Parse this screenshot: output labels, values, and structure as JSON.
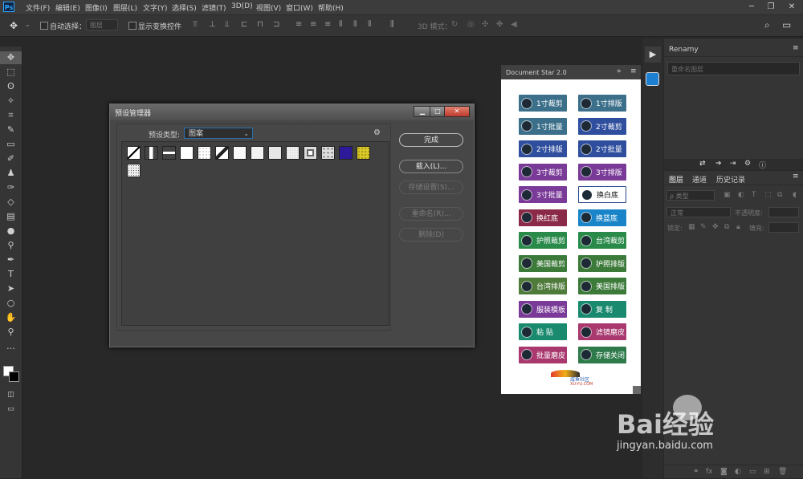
{
  "app": {
    "logo": "Ps"
  },
  "menu": [
    "文件(F)",
    "编辑(E)",
    "图像(I)",
    "图层(L)",
    "文字(Y)",
    "选择(S)",
    "滤镜(T)",
    "3D(D)",
    "视图(V)",
    "窗口(W)",
    "帮助(H)"
  ],
  "window_controls": [
    "─",
    "❐",
    "✕"
  ],
  "options": {
    "auto_select_label": "自动选择：",
    "auto_select_value": "图层",
    "show_transform_label": "显示变换控件",
    "mode_label": "3D 模式："
  },
  "dialog": {
    "title": "预设管理器",
    "preset_type_label": "预设类型:",
    "preset_type_value": "图案",
    "buttons": {
      "done": "完成",
      "load": "载入(L)...",
      "save": "存储设置(S)...",
      "rename": "重命名(R)...",
      "delete": "删除(D)"
    }
  },
  "docstar": {
    "title": "Document Star 2.0",
    "header_controls": "»",
    "buttons": [
      {
        "label": "1寸裁剪",
        "color": "#3b6f8a"
      },
      {
        "label": "1寸排版",
        "color": "#3b6f8a"
      },
      {
        "label": "1寸批量",
        "color": "#3b6f8a"
      },
      {
        "label": "2寸裁剪",
        "color": "#2f4f9e"
      },
      {
        "label": "2寸排版",
        "color": "#2f4f9e"
      },
      {
        "label": "2寸批量",
        "color": "#2f4f9e"
      },
      {
        "label": "3寸裁剪",
        "color": "#7a3a98"
      },
      {
        "label": "3寸排版",
        "color": "#7a3a98"
      },
      {
        "label": "3寸批量",
        "color": "#7a3a98"
      },
      {
        "label": "换白底",
        "color": "#ffffff"
      },
      {
        "label": "换红底",
        "color": "#8a2a48"
      },
      {
        "label": "换蓝底",
        "color": "#1a84c8"
      },
      {
        "label": "护照裁剪",
        "color": "#2a8a4a"
      },
      {
        "label": "台湾裁剪",
        "color": "#2a8a4a"
      },
      {
        "label": "美国裁剪",
        "color": "#3c7a3a"
      },
      {
        "label": "护照排版",
        "color": "#3c7a3a"
      },
      {
        "label": "台湾排版",
        "color": "#4e7a3a"
      },
      {
        "label": "美国排版",
        "color": "#3c7a3a"
      },
      {
        "label": "服装模板",
        "color": "#7a3a98"
      },
      {
        "label": "复  制",
        "color": "#1a8a6e"
      },
      {
        "label": "粘  贴",
        "color": "#1a8a6e"
      },
      {
        "label": "滤镜磨皮",
        "color": "#a8386e"
      },
      {
        "label": "批量磨皮",
        "color": "#a8386e"
      },
      {
        "label": "存储关闭",
        "color": "#2e7a4a"
      }
    ],
    "footer_logo": "咸鱼社区",
    "footer_url": "XU-YU.COM"
  },
  "panels": {
    "renamy_tab": "Renamy",
    "renamy_placeholder": "重命名图层",
    "layers_tabs": [
      "图层",
      "通道",
      "历史记录"
    ],
    "kind_filter": "ρ 类型",
    "blend_mode": "正常",
    "opacity_label": "不透明度:",
    "lock_label": "锁定:",
    "fill_label": "填充:"
  },
  "watermark": {
    "brand": "Bai经验",
    "url": "jingyan.baidu.com"
  }
}
